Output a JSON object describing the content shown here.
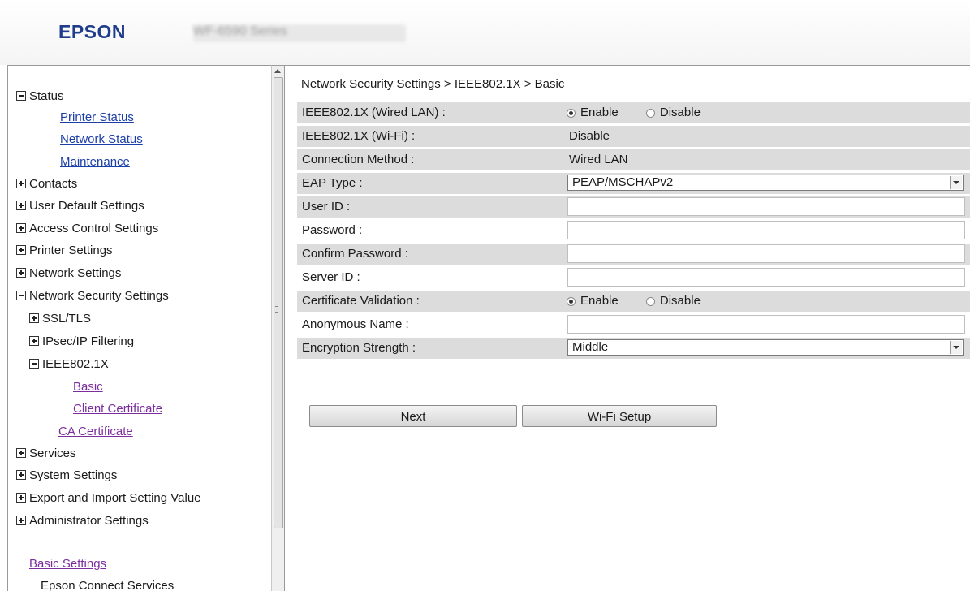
{
  "header": {
    "logo": "EPSON",
    "model": "WF-6590 Series"
  },
  "nav": {
    "status": "Status",
    "printer_status": "Printer Status",
    "network_status": "Network Status",
    "maintenance": "Maintenance",
    "contacts": "Contacts",
    "user_default": "User Default Settings",
    "access_control": "Access Control Settings",
    "printer_settings": "Printer Settings",
    "network_settings": "Network Settings",
    "network_security": "Network Security Settings",
    "ssl_tls": "SSL/TLS",
    "ipsec": "IPsec/IP Filtering",
    "ieee8021x": "IEEE802.1X",
    "basic": "Basic",
    "client_cert": "Client Certificate",
    "ca_cert": "CA Certificate",
    "services": "Services",
    "system_settings": "System Settings",
    "export_import": "Export and Import Setting Value",
    "admin_settings": "Administrator Settings",
    "basic_settings": "Basic Settings",
    "epson_connect": "Epson Connect Services"
  },
  "breadcrumb": "Network Security Settings > IEEE802.1X > Basic",
  "form": {
    "wired_label": "IEEE802.1X (Wired LAN) :",
    "wired_enable": "Enable",
    "wired_disable": "Disable",
    "wifi_label": "IEEE802.1X (Wi-Fi) :",
    "wifi_value": "Disable",
    "conn_label": "Connection Method :",
    "conn_value": "Wired LAN",
    "eap_label": "EAP Type :",
    "eap_value": "PEAP/MSCHAPv2",
    "userid_label": "User ID :",
    "userid_value": "",
    "password_label": "Password :",
    "password_value": "",
    "confirm_label": "Confirm Password :",
    "confirm_value": "",
    "serverid_label": "Server ID :",
    "serverid_value": "",
    "certval_label": "Certificate Validation :",
    "certval_enable": "Enable",
    "certval_disable": "Disable",
    "anon_label": "Anonymous Name :",
    "anon_value": "",
    "enc_label": "Encryption Strength :",
    "enc_value": "Middle"
  },
  "buttons": {
    "next": "Next",
    "wifi_setup": "Wi-Fi Setup"
  }
}
